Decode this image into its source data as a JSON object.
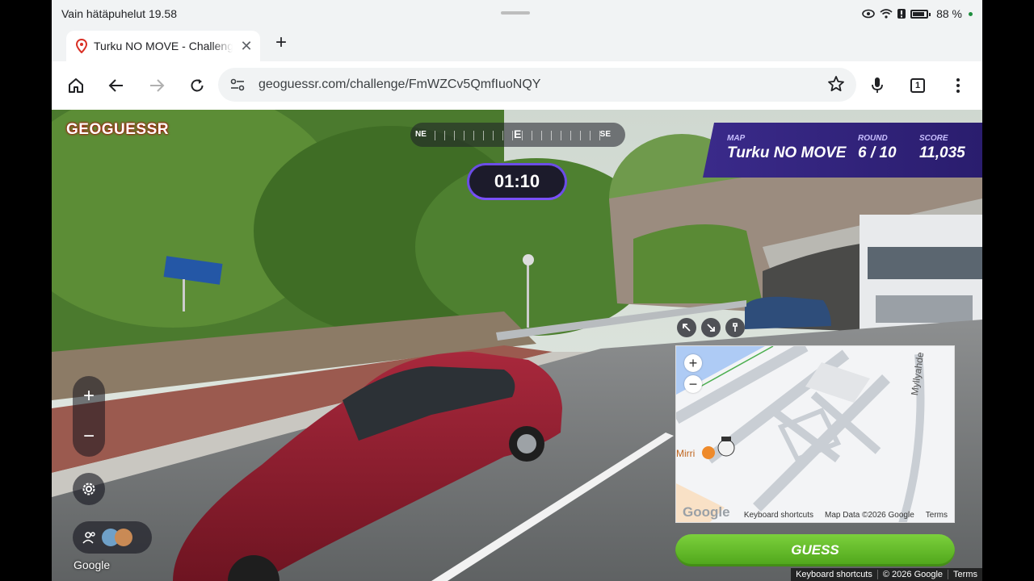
{
  "statusbar": {
    "left_text": "Vain hätäpuhelut 19.58",
    "battery": "88 %"
  },
  "browser": {
    "tab_title": "Turku NO MOVE - Challenge",
    "url": "geoguessr.com/challenge/FmWZCv5QmfIuoNQY",
    "tab_count": "1"
  },
  "game": {
    "logo": "GEOGUESSR",
    "compass": {
      "left": "NE",
      "center": "E",
      "right": "SE"
    },
    "timer": "01:10",
    "info": {
      "map_label": "MAP",
      "map_value": "Turku NO MOVE",
      "round_label": "ROUND",
      "round_value": "6 / 10",
      "score_label": "SCORE",
      "score_value": "11,035"
    },
    "zoom_in": "+",
    "zoom_out": "−",
    "pano_attrib": "Google",
    "minimap": {
      "zoom_in": "+",
      "zoom_out": "−",
      "street_1": "Myllyahde",
      "poi": "Mirri",
      "google_logo": "Google",
      "keyboard_shortcuts": "Keyboard shortcuts",
      "map_data": "Map Data ©2026 Google",
      "terms": "Terms"
    },
    "guess_button": "GUESS",
    "bottom_attrib": {
      "keyboard_shortcuts": "Keyboard shortcuts",
      "copyright": "© 2026 Google",
      "terms": "Terms"
    }
  },
  "colors": {
    "guess_green": "#5cb82a",
    "info_purple": "#2f2277",
    "logo_red": "#c8102e"
  }
}
